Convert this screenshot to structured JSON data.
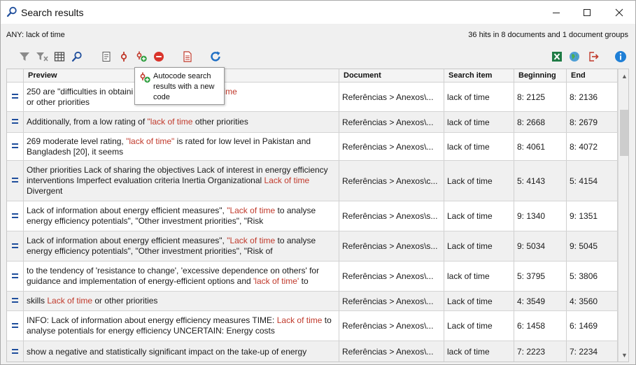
{
  "window": {
    "title": "Search results"
  },
  "query": "ANY: lack of time",
  "hits_summary": "36 hits in 8 documents and 1 document groups",
  "tooltip": {
    "text": "Autocode search results with a new code"
  },
  "columns": {
    "preview": "Preview",
    "document": "Document",
    "search_item": "Search item",
    "beginning": "Beginning",
    "end": "End"
  },
  "row_marker": "=",
  "rows": [
    {
      "p1": "250 are \"difficulties in obtaini",
      "p1b": " of equipment\", ",
      "hl": "\"lack of time",
      "p2": "or other priorities",
      "document": "Referências > Anexos\\...",
      "search_item": "lack of time",
      "beginning": "8: 2125",
      "end": "8: 2136"
    },
    {
      "p1": "Additionally, from a low rating of ",
      "hl": "\"lack of time",
      "p2": " other priorities",
      "document": "Referências > Anexos\\...",
      "search_item": "lack of time",
      "beginning": "8: 2668",
      "end": "8: 2679"
    },
    {
      "p1": "269 moderate level rating, ",
      "hl": "\"lack of time\"",
      "p2": " is rated for low level in Pakistan and Bangladesh [20], it seems",
      "document": "Referências > Anexos\\...",
      "search_item": "lack of time",
      "beginning": "8: 4061",
      "end": "8: 4072"
    },
    {
      "p1": "Other priorities  Lack of sharing the objectives  Lack of interest in energy efficiency interventions  Imperfect evaluation criteria  Inertia  Organizational ",
      "hl": "Lack of time",
      "p2": " Divergent",
      "document": "Referências > Anexos\\c...",
      "search_item": "Lack of time",
      "beginning": "5: 4143",
      "end": "5: 4154"
    },
    {
      "p1": "Lack of information about energy efficient measures\", ",
      "hl": "\"Lack of time",
      "p2": " to analyse energy efficiency potentials\", \"Other investment priorities\", \"Risk",
      "document": "Referências > Anexos\\s...",
      "search_item": "Lack of time",
      "beginning": "9: 1340",
      "end": "9: 1351"
    },
    {
      "p1": "Lack of information about energy efficient measures\", ",
      "hl": "\"Lack of time",
      "p2": " to analyse energy efficiency potentials\", \"Other investment priorities\", \"Risk of",
      "document": "Referências > Anexos\\s...",
      "search_item": "Lack of time",
      "beginning": "9: 5034",
      "end": "9: 5045"
    },
    {
      "p1": "to the tendency of 'resistance to change', 'excessive dependence on others'  for guidance and implementation of energy-efficient options and ",
      "hl": "'lack of time'",
      "p2": " to",
      "document": "Referências > Anexos\\...",
      "search_item": "lack of time",
      "beginning": "5: 3795",
      "end": "5: 3806"
    },
    {
      "p1": "skills  ",
      "hl": "Lack of time",
      "p2": " or other priorities",
      "document": "Referências > Anexos\\...",
      "search_item": "Lack of time",
      "beginning": "4: 3549",
      "end": "4: 3560"
    },
    {
      "p1": "INFO: Lack of information about energy efficiency measures  TIME: ",
      "hl": "Lack of time",
      "p2": " to analyse potentials for energy efficiency  UNCERTAIN: Energy costs",
      "document": "Referências > Anexos\\...",
      "search_item": "Lack of time",
      "beginning": "6: 1458",
      "end": "6: 1469"
    },
    {
      "p1": "show a negative and statistically  significant impact on the take-up of energy",
      "hl": "",
      "p2": "",
      "document": "Referências > Anexos\\...",
      "search_item": "lack of time",
      "beginning": "7: 2223",
      "end": "7: 2234"
    }
  ],
  "toolbar": [
    "filter-icon",
    "clear-filter-icon",
    "columns-icon",
    "search-icon",
    "document-preview-icon",
    "activate-code-icon",
    "autocode-icon",
    "delete-icon",
    "report-icon",
    "refresh-icon",
    "excel-export-icon",
    "web-export-icon",
    "export-icon",
    "help-icon"
  ],
  "colors": {
    "highlight": "#c0392b",
    "marker": "#1f4e9c",
    "accent_blue": "#1f6fc4"
  }
}
